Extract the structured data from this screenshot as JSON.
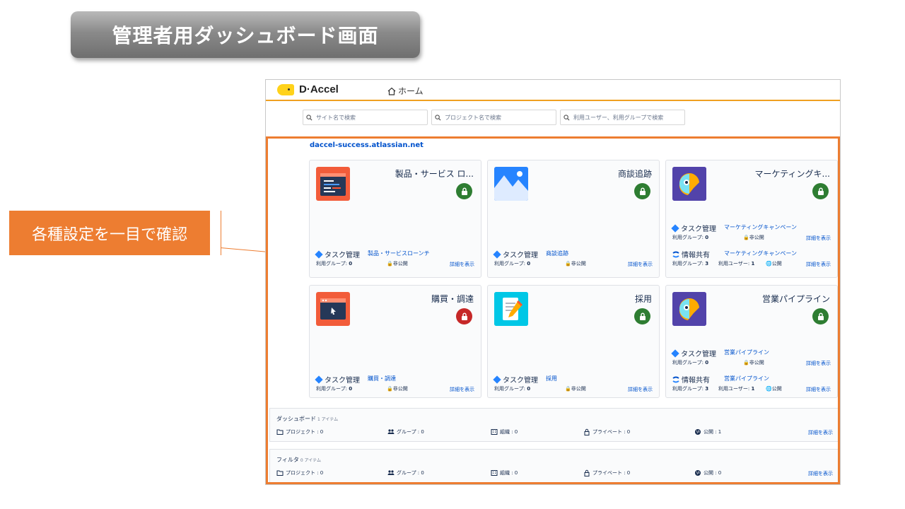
{
  "slide": {
    "title": "管理者用ダッシュボード画面",
    "callout": "各種設定を一目で確認"
  },
  "header": {
    "logo_text": "D·Accel",
    "home_label": "ホーム"
  },
  "search": {
    "site_placeholder": "サイト名で検索",
    "project_placeholder": "プロジェクト名で検索",
    "user_placeholder": "利用ユーザー、利用グループで検索"
  },
  "site": {
    "url": "daccel-success.atlassian.net"
  },
  "colors": {
    "accent_orange": "#ed7d31",
    "lock_green": "#2e7d32",
    "lock_red": "#c62828",
    "link_blue": "#0052cc"
  },
  "cards": [
    {
      "title": "製品・サービス ロ...",
      "icon": "code-window-icon",
      "lock_status": "green",
      "apps": [
        {
          "name": "タスク管理",
          "kind": "jira",
          "project": "製品・サービスローンチ",
          "group_label": "利用グループ:",
          "group_count": "0",
          "visibility": "非公開",
          "details": "詳細を表示"
        }
      ]
    },
    {
      "title": "商談追跡",
      "icon": "mountain-icon",
      "lock_status": "green",
      "apps": [
        {
          "name": "タスク管理",
          "kind": "jira",
          "project": "商談追跡",
          "group_label": "利用グループ:",
          "group_count": "0",
          "visibility": "非公開",
          "details": "詳細を表示"
        }
      ]
    },
    {
      "title": "マーケティングキ...",
      "icon": "bird-icon",
      "lock_status": "green",
      "apps": [
        {
          "name": "タスク管理",
          "kind": "jira",
          "project": "マーケティングキャンペーン",
          "group_label": "利用グループ:",
          "group_count": "0",
          "visibility": "非公開",
          "details": "詳細を表示"
        },
        {
          "name": "情報共有",
          "kind": "confluence",
          "project": "マーケティングキャンペーン",
          "group_label": "利用グループ:",
          "group_count": "3",
          "users_label": "利用ユーザー:",
          "users_count": "1",
          "visibility": "公開",
          "details": "詳細を表示"
        }
      ]
    },
    {
      "title": "購買・調達",
      "icon": "cursor-window-icon",
      "lock_status": "red",
      "apps": [
        {
          "name": "タスク管理",
          "kind": "jira",
          "project": "購買・調達",
          "group_label": "利用グループ:",
          "group_count": "0",
          "visibility": "非公開",
          "details": "詳細を表示"
        }
      ]
    },
    {
      "title": "採用",
      "icon": "notebook-icon",
      "lock_status": "green",
      "apps": [
        {
          "name": "タスク管理",
          "kind": "jira",
          "project": "採用",
          "group_label": "利用グループ:",
          "group_count": "0",
          "visibility": "非公開",
          "details": "詳細を表示"
        }
      ]
    },
    {
      "title": "営業パイプライン",
      "icon": "bird-icon",
      "lock_status": "green",
      "apps": [
        {
          "name": "タスク管理",
          "kind": "jira",
          "project": "営業パイプライン",
          "group_label": "利用グループ:",
          "group_count": "0",
          "visibility": "非公開",
          "details": "詳細を表示"
        },
        {
          "name": "情報共有",
          "kind": "confluence",
          "project": "営業パイプライン",
          "group_label": "利用グループ:",
          "group_count": "3",
          "users_label": "利用ユーザー:",
          "users_count": "1",
          "visibility": "公開",
          "details": "詳細を表示"
        }
      ]
    }
  ],
  "sections": [
    {
      "title": "ダッシュボード",
      "count": "1 アイテム",
      "stats": [
        {
          "label": "プロジェクト : 0",
          "icon": "folder-icon"
        },
        {
          "label": "グループ : 0",
          "icon": "group-icon"
        },
        {
          "label": "組織 : 0",
          "icon": "organization-icon"
        },
        {
          "label": "プライベート : 0",
          "icon": "lock-icon"
        },
        {
          "label": "公開 : 1",
          "icon": "globe-icon"
        }
      ],
      "details": "詳細を表示"
    },
    {
      "title": "フィルタ",
      "count": "0 アイテム",
      "stats": [
        {
          "label": "プロジェクト : 0",
          "icon": "folder-icon"
        },
        {
          "label": "グループ : 0",
          "icon": "group-icon"
        },
        {
          "label": "組織 : 0",
          "icon": "organization-icon"
        },
        {
          "label": "プライベート : 0",
          "icon": "lock-icon"
        },
        {
          "label": "公開 : 0",
          "icon": "globe-icon"
        }
      ],
      "details": "詳細を表示"
    }
  ]
}
